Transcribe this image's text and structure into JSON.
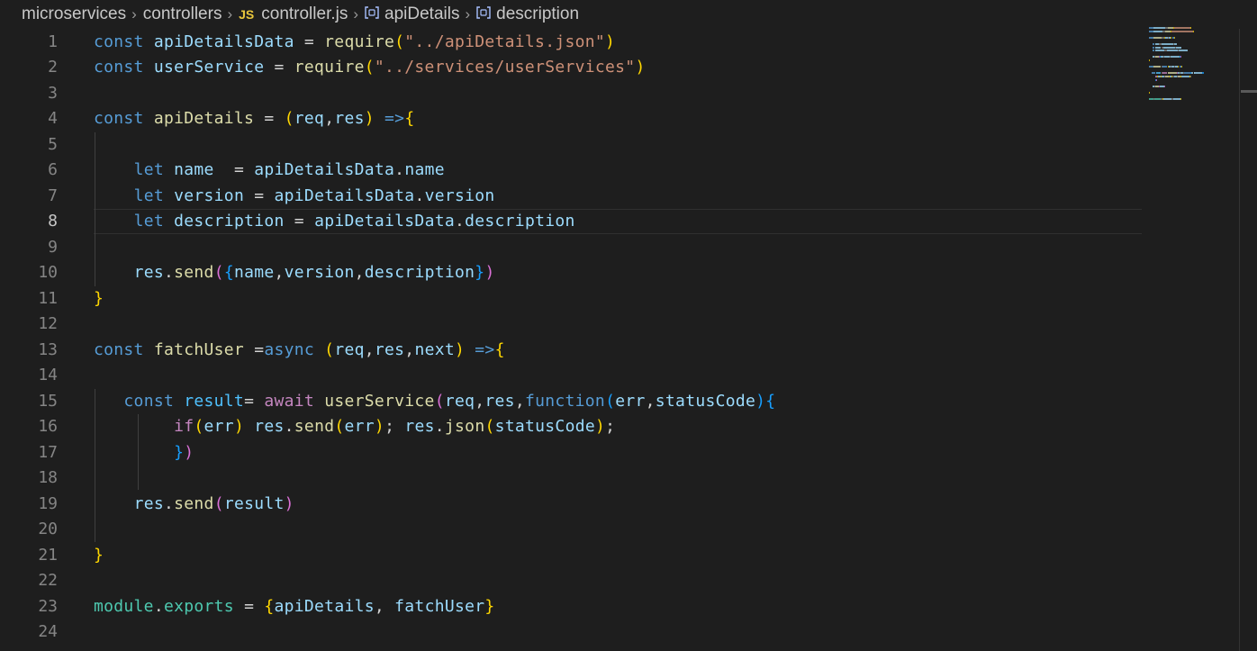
{
  "breadcrumb": {
    "items": [
      {
        "label": "microservices"
      },
      {
        "label": "controllers"
      },
      {
        "label": "controller.js",
        "icon": "js-file-icon",
        "icon_text": "JS"
      },
      {
        "label": "apiDetails",
        "icon": "variable-symbol-icon"
      },
      {
        "label": "description",
        "icon": "variable-symbol-icon"
      }
    ],
    "separator": "›"
  },
  "editor": {
    "active_line": 8,
    "line_numbers": [
      "1",
      "2",
      "3",
      "4",
      "5",
      "6",
      "7",
      "8",
      "9",
      "10",
      "11",
      "12",
      "13",
      "14",
      "15",
      "16",
      "17",
      "18",
      "19",
      "20",
      "21",
      "22",
      "23",
      "24"
    ],
    "lines": [
      [
        [
          "kw",
          "const"
        ],
        [
          "op",
          " "
        ],
        [
          "var",
          "apiDetailsData"
        ],
        [
          "op",
          " = "
        ],
        [
          "fn",
          "require"
        ],
        [
          "b1",
          "("
        ],
        [
          "str",
          "\"../apiDetails.json\""
        ],
        [
          "b1",
          ")"
        ]
      ],
      [
        [
          "kw",
          "const"
        ],
        [
          "op",
          " "
        ],
        [
          "var",
          "userService"
        ],
        [
          "op",
          " = "
        ],
        [
          "fn",
          "require"
        ],
        [
          "b1",
          "("
        ],
        [
          "str",
          "\"../services/userServices\""
        ],
        [
          "b1",
          ")"
        ]
      ],
      [],
      [
        [
          "kw",
          "const"
        ],
        [
          "op",
          " "
        ],
        [
          "fn",
          "apiDetails"
        ],
        [
          "op",
          " = "
        ],
        [
          "b1",
          "("
        ],
        [
          "var",
          "req"
        ],
        [
          "op",
          ","
        ],
        [
          "var",
          "res"
        ],
        [
          "b1",
          ")"
        ],
        [
          "op",
          " "
        ],
        [
          "kw",
          "=>"
        ],
        [
          "b1",
          "{"
        ]
      ],
      [],
      [
        [
          "op",
          "    "
        ],
        [
          "kw",
          "let"
        ],
        [
          "op",
          " "
        ],
        [
          "var",
          "name"
        ],
        [
          "op",
          "  = "
        ],
        [
          "var",
          "apiDetailsData"
        ],
        [
          "op",
          "."
        ],
        [
          "var",
          "name"
        ]
      ],
      [
        [
          "op",
          "    "
        ],
        [
          "kw",
          "let"
        ],
        [
          "op",
          " "
        ],
        [
          "var",
          "version"
        ],
        [
          "op",
          " = "
        ],
        [
          "var",
          "apiDetailsData"
        ],
        [
          "op",
          "."
        ],
        [
          "var",
          "version"
        ]
      ],
      [
        [
          "op",
          "    "
        ],
        [
          "kw",
          "let"
        ],
        [
          "op",
          " "
        ],
        [
          "var",
          "description"
        ],
        [
          "op",
          " = "
        ],
        [
          "var",
          "apiDetailsData"
        ],
        [
          "op",
          "."
        ],
        [
          "var",
          "description"
        ]
      ],
      [],
      [
        [
          "op",
          "    "
        ],
        [
          "var",
          "res"
        ],
        [
          "op",
          "."
        ],
        [
          "fn",
          "send"
        ],
        [
          "b2",
          "("
        ],
        [
          "b3",
          "{"
        ],
        [
          "var",
          "name"
        ],
        [
          "op",
          ","
        ],
        [
          "var",
          "version"
        ],
        [
          "op",
          ","
        ],
        [
          "var",
          "description"
        ],
        [
          "b3",
          "}"
        ],
        [
          "b2",
          ")"
        ]
      ],
      [
        [
          "b1",
          "}"
        ]
      ],
      [],
      [
        [
          "kw",
          "const"
        ],
        [
          "op",
          " "
        ],
        [
          "fn",
          "fatchUser"
        ],
        [
          "op",
          " ="
        ],
        [
          "kw",
          "async"
        ],
        [
          "op",
          " "
        ],
        [
          "b1",
          "("
        ],
        [
          "var",
          "req"
        ],
        [
          "op",
          ","
        ],
        [
          "var",
          "res"
        ],
        [
          "op",
          ","
        ],
        [
          "var",
          "next"
        ],
        [
          "b1",
          ")"
        ],
        [
          "op",
          " "
        ],
        [
          "kw",
          "=>"
        ],
        [
          "b1",
          "{"
        ]
      ],
      [],
      [
        [
          "op",
          "   "
        ],
        [
          "kw",
          "const"
        ],
        [
          "op",
          " "
        ],
        [
          "cst",
          "result"
        ],
        [
          "op",
          "= "
        ],
        [
          "ctl",
          "await"
        ],
        [
          "op",
          " "
        ],
        [
          "fn",
          "userService"
        ],
        [
          "b2",
          "("
        ],
        [
          "var",
          "req"
        ],
        [
          "op",
          ","
        ],
        [
          "var",
          "res"
        ],
        [
          "op",
          ","
        ],
        [
          "kw",
          "function"
        ],
        [
          "b3",
          "("
        ],
        [
          "var",
          "err"
        ],
        [
          "op",
          ","
        ],
        [
          "var",
          "statusCode"
        ],
        [
          "b3",
          ")"
        ],
        [
          "b3",
          "{"
        ]
      ],
      [
        [
          "op",
          "        "
        ],
        [
          "ctl",
          "if"
        ],
        [
          "b1",
          "("
        ],
        [
          "var",
          "err"
        ],
        [
          "b1",
          ")"
        ],
        [
          "op",
          " "
        ],
        [
          "var",
          "res"
        ],
        [
          "op",
          "."
        ],
        [
          "fn",
          "send"
        ],
        [
          "b1",
          "("
        ],
        [
          "var",
          "err"
        ],
        [
          "b1",
          ")"
        ],
        [
          "op",
          "; "
        ],
        [
          "var",
          "res"
        ],
        [
          "op",
          "."
        ],
        [
          "fn",
          "json"
        ],
        [
          "b1",
          "("
        ],
        [
          "var",
          "statusCode"
        ],
        [
          "b1",
          ")"
        ],
        [
          "op",
          ";"
        ]
      ],
      [
        [
          "op",
          "        "
        ],
        [
          "b3",
          "}"
        ],
        [
          "b2",
          ")"
        ]
      ],
      [],
      [
        [
          "op",
          "    "
        ],
        [
          "var",
          "res"
        ],
        [
          "op",
          "."
        ],
        [
          "fn",
          "send"
        ],
        [
          "b2",
          "("
        ],
        [
          "var",
          "result"
        ],
        [
          "b2",
          ")"
        ]
      ],
      [],
      [
        [
          "b1",
          "}"
        ]
      ],
      [],
      [
        [
          "mod",
          "module"
        ],
        [
          "op",
          "."
        ],
        [
          "mod",
          "exports"
        ],
        [
          "op",
          " = "
        ],
        [
          "b1",
          "{"
        ],
        [
          "var",
          "apiDetails"
        ],
        [
          "op",
          ", "
        ],
        [
          "var",
          "fatchUser"
        ],
        [
          "b1",
          "}"
        ]
      ],
      []
    ]
  },
  "colors": {
    "background": "#1e1e1e",
    "keyword": "#569cd6",
    "variable": "#9cdcfe",
    "function": "#dcdcaa",
    "string": "#ce9178"
  }
}
